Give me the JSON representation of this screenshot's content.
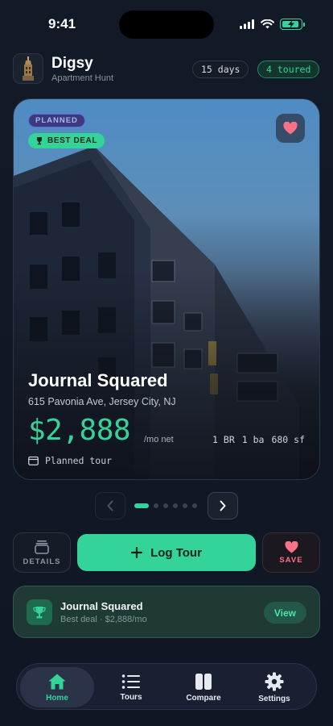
{
  "status_bar": {
    "time": "9:41"
  },
  "header": {
    "app_name": "Digsy",
    "subtitle": "Apartment Hunt",
    "days_chip": "15 days",
    "toured_chip": "4 toured"
  },
  "listing": {
    "status_badge": "PLANNED",
    "deal_badge": "BEST DEAL",
    "name": "Journal Squared",
    "address": "615 Pavonia Ave, Jersey City, NJ",
    "price": "$2,888",
    "price_unit": "/mo net",
    "beds": "1 BR",
    "baths": "1 ba",
    "sqft": "680 sf",
    "tour_status": "Planned tour",
    "favorited": true
  },
  "pager": {
    "total": 6,
    "current": 1
  },
  "actions": {
    "details_label": "DETAILS",
    "log_tour_label": "Log Tour",
    "save_label": "SAVE"
  },
  "best_deal_banner": {
    "title": "Journal Squared",
    "subtitle": "Best deal · $2,888/mo",
    "view_label": "View"
  },
  "tabbar": {
    "active": "Home",
    "tabs": [
      {
        "label": "Home",
        "icon": "home-icon"
      },
      {
        "label": "Tours",
        "icon": "list-icon"
      },
      {
        "label": "Compare",
        "icon": "compare-icon"
      },
      {
        "label": "Settings",
        "icon": "gear-icon"
      }
    ]
  },
  "colors": {
    "accent": "#34d399",
    "background": "#111827",
    "favorite": "#fb7185",
    "planned": "#6366f1"
  }
}
